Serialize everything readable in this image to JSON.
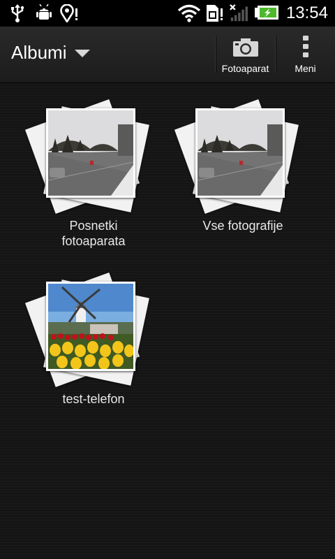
{
  "status_bar": {
    "time": "13:54",
    "icons": [
      "usb-icon",
      "android-debug-icon",
      "location-icon",
      "wifi-icon",
      "sim-icon",
      "signal-icon",
      "battery-charging-icon"
    ]
  },
  "action_bar": {
    "title": "Albumi",
    "camera_label": "Fotoaparat",
    "menu_label": "Meni"
  },
  "albums": [
    {
      "label": "Posnetki fotoaparata",
      "thumbnail": "street-photo"
    },
    {
      "label": "Vse fotografije",
      "thumbnail": "street-photo"
    },
    {
      "label": "test-telefon",
      "thumbnail": "windmill-tulips-photo"
    }
  ]
}
